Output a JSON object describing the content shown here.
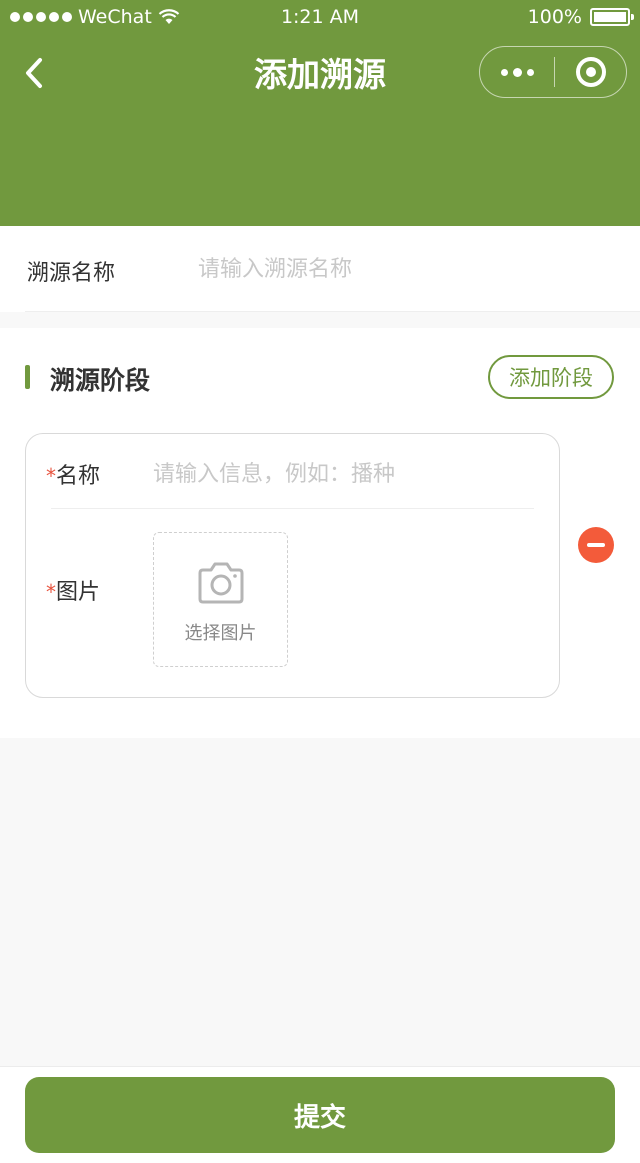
{
  "status_bar": {
    "carrier": "WeChat",
    "time": "1:21 AM",
    "battery": "100%"
  },
  "nav": {
    "title": "添加溯源"
  },
  "trace_name": {
    "label": "溯源名称",
    "placeholder": "请输入溯源名称"
  },
  "stages": {
    "title": "溯源阶段",
    "add_button": "添加阶段",
    "items": [
      {
        "required_mark": "*",
        "name_label": "名称",
        "name_placeholder": "请输入信息，例如：播种",
        "image_label": "图片",
        "upload_label": "选择图片"
      }
    ]
  },
  "footer": {
    "submit": "提交"
  },
  "colors": {
    "primary": "#71993e",
    "danger": "#f35b3a",
    "required": "#e8543f"
  },
  "icons": [
    "back-icon",
    "more-icon",
    "close-miniprogram-icon",
    "camera-icon",
    "remove-icon",
    "wifi-icon",
    "battery-icon"
  ]
}
